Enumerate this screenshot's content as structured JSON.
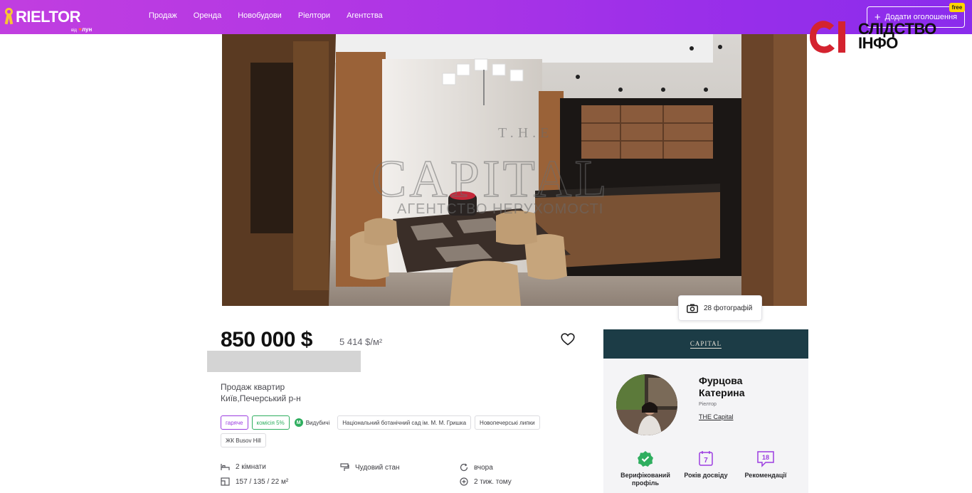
{
  "header": {
    "logo_text": "RIELTOR",
    "logo_sub": "від",
    "logo_sub_brand": "лун",
    "nav": [
      "Продаж",
      "Оренда",
      "Новобудови",
      "Ріелтори",
      "Агентства"
    ],
    "add_button": "Додати оголошення",
    "free_badge": "free"
  },
  "watermark": {
    "mark": "СІ",
    "line1": "СЛІДСТВО",
    "line2": "ІНФО"
  },
  "photo": {
    "overlay_brand_top": "T.H.E",
    "overlay_brand": "CAPITAL",
    "overlay_brand_sub": "АГЕНТСТВО НЕРУХОМОСТІ",
    "count_label": "28 фотографій"
  },
  "listing": {
    "price": "850 000 $",
    "price_per_m2": "5 414 $/м²",
    "deal_type": "Продаж квартир",
    "location": "Київ,Печерський р-н",
    "tags": [
      {
        "label": "гаряче",
        "kind": "hot"
      },
      {
        "label": "комісія 5%",
        "kind": "comm"
      },
      {
        "label": "Видубичі",
        "kind": "metro",
        "metro_letter": "М"
      },
      {
        "label": "Національний ботанічний сад ім. М. М. Гришка",
        "kind": "plain"
      },
      {
        "label": "Новопечерські липки",
        "kind": "plain"
      },
      {
        "label": "ЖК Busov Hill",
        "kind": "plain"
      }
    ],
    "specs": {
      "rooms": "2 кімнати",
      "area": "157 / 135 / 22 м²",
      "condition": "Чудовий стан",
      "updated": "вчора",
      "published": "2 тиж. тому"
    }
  },
  "agent": {
    "agency_banner": "CAPITAL",
    "name": "Фурцова Катерина",
    "role": "Ріелтор",
    "agency": "THE Capital",
    "badges": {
      "verified": "Верифікований профіль",
      "years_value": "7",
      "years_label": "Років досвіду",
      "recommendations_value": "18",
      "recommendations_label": "Рекомендації"
    }
  },
  "colors": {
    "header_gradient_start": "#c13ee0",
    "header_gradient_end": "#8a2cec",
    "accent_purple": "#9b3de0",
    "accent_green": "#2fae5f",
    "agency_banner": "#1c3c46"
  }
}
